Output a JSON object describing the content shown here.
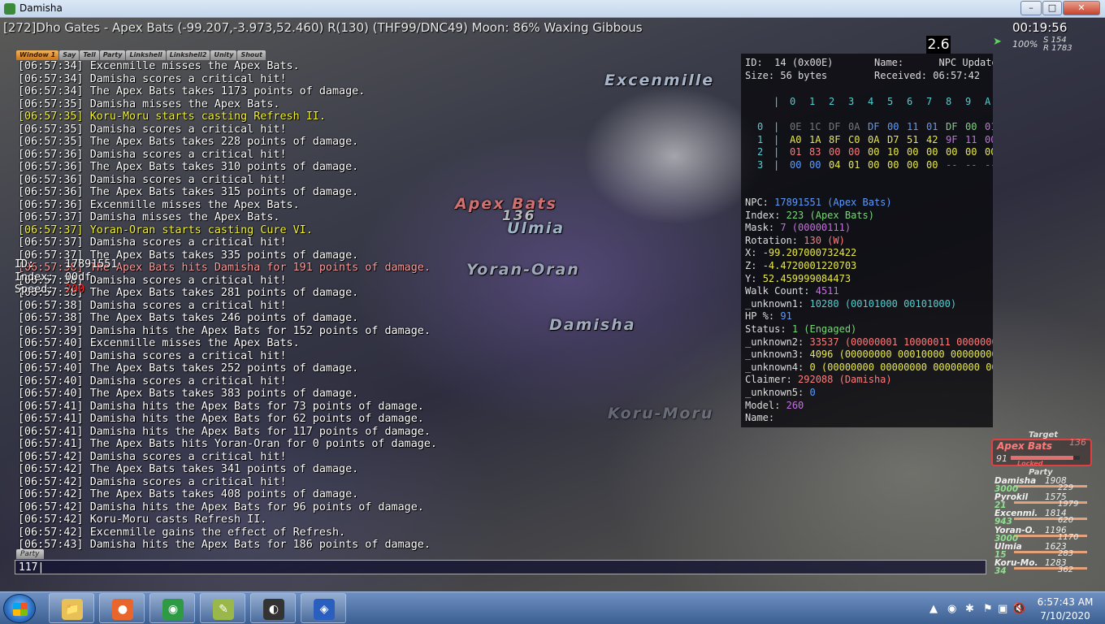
{
  "window": {
    "title": "Damisha",
    "minimize": "–",
    "maximize": "□",
    "close": "✕"
  },
  "hud": {
    "zone_info": "[272]Dho Gates - Apex Bats (-99.207,-3.973,52.460) R(130) (THF99/DNC49) Moon: 86% Waxing Gibbous",
    "clock": "00:19:56",
    "fps": "2.6",
    "compass_pct": "100%",
    "compass_s": "S 154",
    "compass_r": "R 1783"
  },
  "nameplates": [
    {
      "text": "Excenmille",
      "color": "#a8b4c8"
    },
    {
      "text": "Apex Bats",
      "color": "#d07070"
    },
    {
      "text": "136",
      "color": "#b8b8c0"
    },
    {
      "text": "Ulmia",
      "color": "#a0b4c8"
    },
    {
      "text": "Yoran-Oran",
      "color": "#9ea8b8"
    },
    {
      "text": "Damisha",
      "color": "#a0aabc"
    },
    {
      "text": "Koru-Moru",
      "color": "#8a8fa0"
    }
  ],
  "chat_tabs": [
    "Window 1",
    "Say",
    "Tell",
    "Party",
    "Linkshell",
    "Linkshell2",
    "Unity",
    "Shout"
  ],
  "chat": [
    {
      "time": "[06:57:34]",
      "text": "Excenmille misses the Apex Bats.",
      "type": "normal"
    },
    {
      "time": "[06:57:34]",
      "text": "Damisha scores a critical hit!",
      "type": "normal"
    },
    {
      "time": "[06:57:34]",
      "text": "The Apex Bats takes 1173 points of damage.",
      "type": "normal"
    },
    {
      "time": "[06:57:35]",
      "text": "Damisha misses the Apex Bats.",
      "type": "normal"
    },
    {
      "time": "[06:57:35]",
      "text": "Koru-Moru starts casting Refresh II.",
      "type": "cast"
    },
    {
      "time": "[06:57:35]",
      "text": "Damisha scores a critical hit!",
      "type": "normal"
    },
    {
      "time": "[06:57:35]",
      "text": "The Apex Bats takes 228 points of damage.",
      "type": "normal"
    },
    {
      "time": "[06:57:36]",
      "text": "Damisha scores a critical hit!",
      "type": "normal"
    },
    {
      "time": "[06:57:36]",
      "text": "The Apex Bats takes 310 points of damage.",
      "type": "normal"
    },
    {
      "time": "[06:57:36]",
      "text": "Damisha scores a critical hit!",
      "type": "normal"
    },
    {
      "time": "[06:57:36]",
      "text": "The Apex Bats takes 315 points of damage.",
      "type": "normal"
    },
    {
      "time": "[06:57:36]",
      "text": "Excenmille misses the Apex Bats.",
      "type": "normal"
    },
    {
      "time": "[06:57:37]",
      "text": "Damisha misses the Apex Bats.",
      "type": "normal"
    },
    {
      "time": "[06:57:37]",
      "text": "Yoran-Oran starts casting Cure VI.",
      "type": "cast"
    },
    {
      "time": "[06:57:37]",
      "text": "Damisha scores a critical hit!",
      "type": "normal"
    },
    {
      "time": "[06:57:37]",
      "text": "The Apex Bats takes 335 points of damage.",
      "type": "normal"
    },
    {
      "time": "[06:57:38]",
      "text": "The Apex Bats hits Damisha for 191 points of damage.",
      "type": "hurt"
    },
    {
      "time": "[06:57:38]",
      "text": "Damisha scores a critical hit!",
      "type": "normal"
    },
    {
      "time": "[06:57:38]",
      "text": "The Apex Bats takes 281 points of damage.",
      "type": "normal"
    },
    {
      "time": "[06:57:38]",
      "text": "Damisha scores a critical hit!",
      "type": "normal"
    },
    {
      "time": "[06:57:38]",
      "text": "The Apex Bats takes 246 points of damage.",
      "type": "normal"
    },
    {
      "time": "[06:57:39]",
      "text": "Damisha hits the Apex Bats for 152 points of damage.",
      "type": "normal"
    },
    {
      "time": "[06:57:40]",
      "text": "Excenmille misses the Apex Bats.",
      "type": "normal"
    },
    {
      "time": "[06:57:40]",
      "text": "Damisha scores a critical hit!",
      "type": "normal"
    },
    {
      "time": "[06:57:40]",
      "text": "The Apex Bats takes 252 points of damage.",
      "type": "normal"
    },
    {
      "time": "[06:57:40]",
      "text": "Damisha scores a critical hit!",
      "type": "normal"
    },
    {
      "time": "[06:57:40]",
      "text": "The Apex Bats takes 383 points of damage.",
      "type": "normal"
    },
    {
      "time": "[06:57:41]",
      "text": "Damisha hits the Apex Bats for 73 points of damage.",
      "type": "normal"
    },
    {
      "time": "[06:57:41]",
      "text": "Damisha hits the Apex Bats for 62 points of damage.",
      "type": "normal"
    },
    {
      "time": "[06:57:41]",
      "text": "Damisha hits the Apex Bats for 117 points of damage.",
      "type": "normal"
    },
    {
      "time": "[06:57:41]",
      "text": "The Apex Bats hits Yoran-Oran for 0 points of damage.",
      "type": "normal"
    },
    {
      "time": "[06:57:42]",
      "text": "Damisha scores a critical hit!",
      "type": "normal"
    },
    {
      "time": "[06:57:42]",
      "text": "The Apex Bats takes 341 points of damage.",
      "type": "normal"
    },
    {
      "time": "[06:57:42]",
      "text": "Damisha scores a critical hit!",
      "type": "normal"
    },
    {
      "time": "[06:57:42]",
      "text": "The Apex Bats takes 408 points of damage.",
      "type": "normal"
    },
    {
      "time": "[06:57:42]",
      "text": "Damisha hits the Apex Bats for 96 points of damage.",
      "type": "normal"
    },
    {
      "time": "[06:57:42]",
      "text": "Koru-Moru casts Refresh II.",
      "type": "normal"
    },
    {
      "time": "[06:57:42]",
      "text": "Excenmille gains the effect of Refresh.",
      "type": "normal"
    },
    {
      "time": "[06:57:43]",
      "text": "Damisha hits the Apex Bats for 186 points of damage.",
      "type": "normal"
    }
  ],
  "overlay_info": {
    "id_label": "ID:",
    "id_value": "17891551",
    "index_label": "Index:",
    "index_value": "00df",
    "speed_label": "Speed:",
    "speed_value": "200"
  },
  "chat_input": {
    "tab": "Party",
    "value": "117|"
  },
  "packet": {
    "id_label": "ID:",
    "id_value": "14 (0x00E)",
    "size_label": "Size:",
    "size_value": "56 bytes",
    "name_label": "Name:",
    "name_value": "NPC Update",
    "received_label": "Received:",
    "received_value": "06:57:42",
    "hex_header": [
      "0",
      "1",
      "2",
      "3",
      "4",
      "5",
      "6",
      "7",
      "8",
      "9",
      "A",
      "B",
      "C",
      "D",
      "E",
      "F"
    ],
    "hex_rows": [
      {
        "row": "0",
        "bytes": [
          [
            "0E",
            "#777"
          ],
          [
            "1C",
            "#777"
          ],
          [
            "DF",
            "#777"
          ],
          [
            "0A",
            "#777"
          ],
          [
            "DF",
            "#5b9bff"
          ],
          [
            "00",
            "#5b9bff"
          ],
          [
            "11",
            "#5b9bff"
          ],
          [
            "01",
            "#5b9bff"
          ],
          [
            "DF",
            "#7ad67a"
          ],
          [
            "00",
            "#7ad67a"
          ],
          [
            "01",
            "#c770e0"
          ],
          [
            "82",
            "#ff7a7a"
          ],
          [
            "FC",
            "#e8e84a"
          ],
          [
            "69",
            "#e8e84a"
          ],
          [
            "C6",
            "#e8e84a"
          ],
          [
            "C2",
            "#e8e84a"
          ]
        ]
      },
      {
        "row": "1",
        "bytes": [
          [
            "A0",
            "#e8e84a"
          ],
          [
            "1A",
            "#e8e84a"
          ],
          [
            "8F",
            "#e8e84a"
          ],
          [
            "C0",
            "#e8e84a"
          ],
          [
            "0A",
            "#e8e84a"
          ],
          [
            "D7",
            "#e8e84a"
          ],
          [
            "51",
            "#e8e84a"
          ],
          [
            "42",
            "#e8e84a"
          ],
          [
            "9F",
            "#c770e0"
          ],
          [
            "11",
            "#c770e0"
          ],
          [
            "00",
            "#c770e0"
          ],
          [
            "00",
            "#c770e0"
          ],
          [
            "28",
            "#4fd0d0"
          ],
          [
            "28",
            "#4fd0d0"
          ],
          [
            "58",
            "#5b9bff"
          ],
          [
            "01",
            "#e8e84a"
          ]
        ]
      },
      {
        "row": "2",
        "bytes": [
          [
            "01",
            "#ff7a7a"
          ],
          [
            "83",
            "#ff7a7a"
          ],
          [
            "00",
            "#ff7a7a"
          ],
          [
            "00",
            "#ff7a7a"
          ],
          [
            "00",
            "#e8e84a"
          ],
          [
            "10",
            "#e8e84a"
          ],
          [
            "00",
            "#e8e84a"
          ],
          [
            "00",
            "#e8e84a"
          ],
          [
            "00",
            "#e8e84a"
          ],
          [
            "00",
            "#e8e84a"
          ],
          [
            "00",
            "#e8e84a"
          ],
          [
            "00",
            "#e8e84a"
          ],
          [
            "F8",
            "#ff7a7a"
          ],
          [
            "74",
            "#ff7a7a"
          ],
          [
            "04",
            "#ff7a7a"
          ],
          [
            "00",
            "#ff7a7a"
          ]
        ]
      },
      {
        "row": "3",
        "bytes": [
          [
            "00",
            "#5b9bff"
          ],
          [
            "00",
            "#5b9bff"
          ],
          [
            "04",
            "#e8e84a"
          ],
          [
            "01",
            "#e8e84a"
          ],
          [
            "00",
            "#e8e84a"
          ],
          [
            "00",
            "#e8e84a"
          ],
          [
            "00",
            "#e8e84a"
          ],
          [
            "00",
            "#e8e84a"
          ],
          [
            "--",
            "#777"
          ],
          [
            "--",
            "#777"
          ],
          [
            "--",
            "#777"
          ],
          [
            "--",
            "#777"
          ],
          [
            "--",
            "#777"
          ],
          [
            "--",
            "#777"
          ],
          [
            "--",
            "#777"
          ],
          [
            "--",
            "#777"
          ]
        ]
      }
    ],
    "fields": [
      {
        "label": "NPC:",
        "value": "17891551 (Apex Bats)",
        "color": "#5b9bff"
      },
      {
        "label": "Index:",
        "value": "223 (Apex Bats)",
        "color": "#7ad67a"
      },
      {
        "label": "Mask:",
        "value": "7 (00000111)",
        "color": "#c770e0"
      },
      {
        "label": "Rotation:",
        "value": "130 (W)",
        "color": "#ff7a7a"
      },
      {
        "label": "X:",
        "value": "-99.207000732422",
        "color": "#e8e84a"
      },
      {
        "label": "Z:",
        "value": "-4.4720001220703",
        "color": "#e8e84a"
      },
      {
        "label": "Y:",
        "value": "52.459999084473",
        "color": "#e8e84a"
      },
      {
        "label": "Walk Count:",
        "value": "4511",
        "color": "#c770e0"
      },
      {
        "label": "_unknown1:",
        "value": "10280 (00101000 00101000)",
        "color": "#4fd0d0"
      },
      {
        "label": "HP %:",
        "value": "91",
        "color": "#5b9bff"
      },
      {
        "label": "Status:",
        "value": "1 (Engaged)",
        "color": "#7ad67a"
      },
      {
        "label": "_unknown2:",
        "value": "33537 (00000001 10000011 00000000 00000000)",
        "color": "#ff7a7a"
      },
      {
        "label": "_unknown3:",
        "value": "4096 (00000000 00010000 00000000 00000000)",
        "color": "#e8e84a"
      },
      {
        "label": "_unknown4:",
        "value": "0 (00000000 00000000 00000000 00000000)",
        "color": "#e8e84a"
      },
      {
        "label": "Claimer:",
        "value": "292088 (Damisha)",
        "color": "#ff7a7a"
      },
      {
        "label": "_unknown5:",
        "value": "0",
        "color": "#5b9bff"
      },
      {
        "label": "Model:",
        "value": "260",
        "color": "#c770e0"
      },
      {
        "label": "Name:",
        "value": "",
        "color": "#ddd"
      }
    ]
  },
  "target": {
    "label": "Target",
    "name": "Apex Bats",
    "hp_num": "136",
    "hp_pct": "91",
    "hp_fraction": 0.91,
    "status": "Locked"
  },
  "party": {
    "label": "Party",
    "members": [
      {
        "name": "Damisha",
        "hp": "1908",
        "mp": "3000",
        "tp": "229",
        "hp_fraction": 1.0
      },
      {
        "name": "Pyrokil",
        "hp": "1575",
        "mp": "21",
        "tp": "1979",
        "hp_fraction": 1.0
      },
      {
        "name": "Excenmi.",
        "hp": "1814",
        "mp": "943",
        "tp": "620",
        "hp_fraction": 1.0
      },
      {
        "name": "Yoran-O.",
        "hp": "1196",
        "mp": "3000",
        "tp": "1170",
        "hp_fraction": 1.0
      },
      {
        "name": "Ulmia",
        "hp": "1623",
        "mp": "15",
        "tp": "283",
        "hp_fraction": 1.0
      },
      {
        "name": "Koru-Mo.",
        "hp": "1283",
        "mp": "34",
        "tp": "362",
        "hp_fraction": 1.0
      }
    ]
  },
  "taskbar": {
    "items": [
      {
        "name": "file-explorer",
        "glyph": "📁",
        "color": "#e8c05a"
      },
      {
        "name": "firefox",
        "glyph": "●",
        "color": "#e8662b"
      },
      {
        "name": "chrome",
        "glyph": "◉",
        "color": "#2f9a44"
      },
      {
        "name": "notepad-app",
        "glyph": "✎",
        "color": "#9ab84a"
      },
      {
        "name": "obs-studio",
        "glyph": "◐",
        "color": "#333333"
      },
      {
        "name": "ffxi-game",
        "glyph": "◈",
        "color": "#2a5fbf"
      }
    ],
    "time": "6:57:43 AM",
    "date": "7/10/2020"
  }
}
